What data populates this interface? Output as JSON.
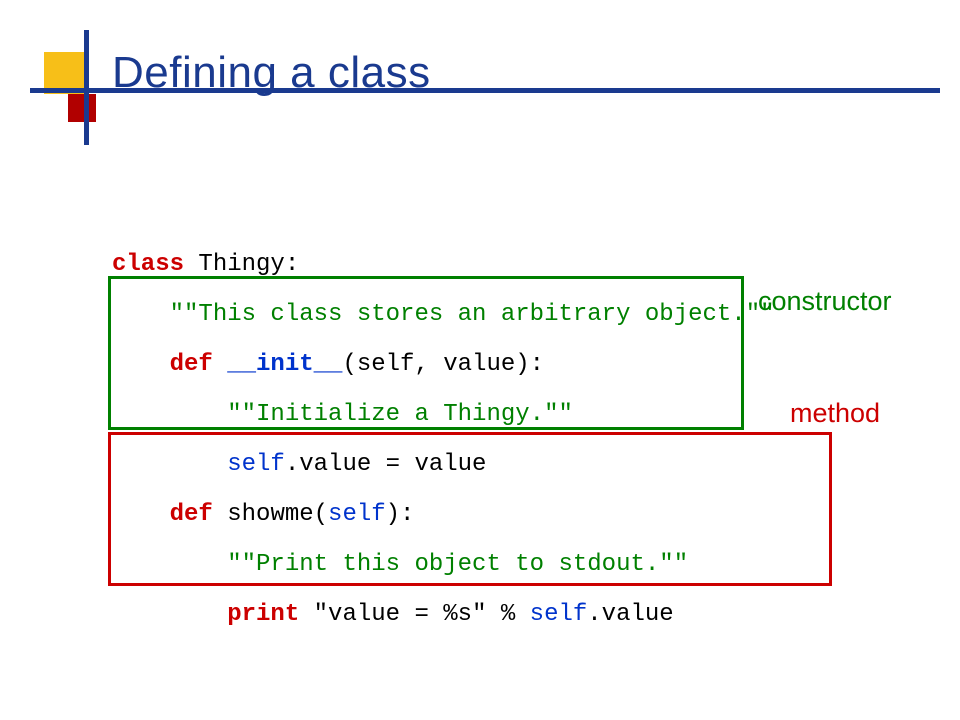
{
  "title": "Defining a class",
  "labels": {
    "constructor": "constructor",
    "method": "method"
  },
  "code": {
    "l1a": "class",
    "l1b": " Thingy:",
    "l2": "\"\"This class stores an arbitrary object.\"\"",
    "l3a": "def ",
    "l3b": "__init__",
    "l3c": "(self, value):",
    "l4": "\"\"Initialize a Thingy.\"\"",
    "l5a": "self",
    "l5b": ".value = value",
    "l6a": "def",
    "l6b": " showme(",
    "l6c": "self",
    "l6d": "):",
    "l7": "\"\"Print this object to stdout.\"\"",
    "l8a": "print",
    "l8b": " \"value = %s\" % ",
    "l8c": "self",
    "l8d": ".value"
  }
}
